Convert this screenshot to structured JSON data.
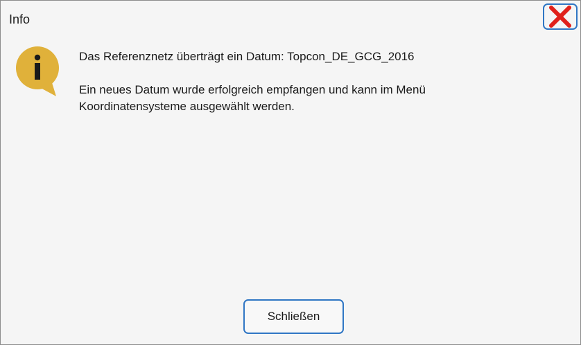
{
  "dialog": {
    "title": "Info",
    "close_icon": "close-x-icon",
    "info_icon": "info-speech-bubble-icon",
    "message_line1": "Das Referenznetz überträgt ein Datum: Topcon_DE_GCG_2016",
    "message_line2": "Ein neues Datum wurde erfolgreich empfangen und kann im Menü",
    "message_line3": "Koordinatensysteme ausgewählt werden.",
    "close_button_label": "Schließen"
  },
  "colors": {
    "accent_border": "#2f76c4",
    "close_x": "#e0211b",
    "info_icon": "#e0b13a"
  }
}
